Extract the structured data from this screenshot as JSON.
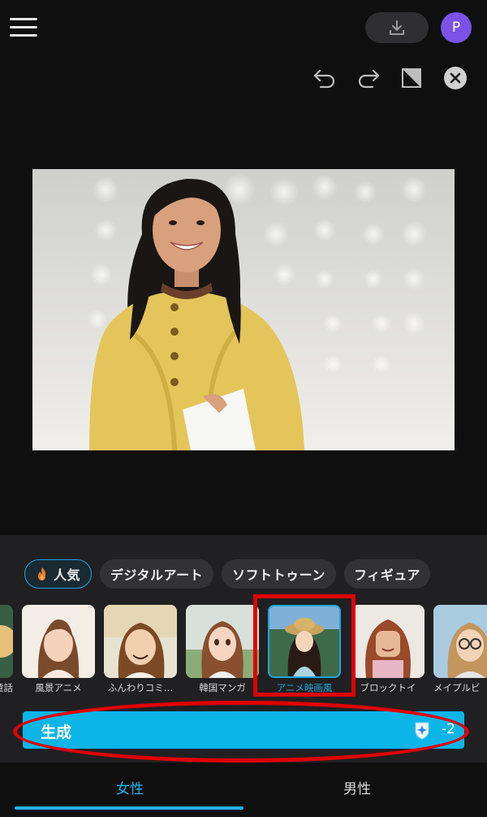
{
  "header": {
    "avatar_letter": "P",
    "menu_icon": "hamburger-icon",
    "download_icon": "download-icon"
  },
  "toolbar": {
    "icons": [
      "undo-icon",
      "redo-icon",
      "compare-icon",
      "close-icon"
    ]
  },
  "categories": [
    {
      "label": "人気",
      "icon": "fire-icon",
      "active": true
    },
    {
      "label": "デジタルアート",
      "active": false
    },
    {
      "label": "ソフトトゥーン",
      "active": false
    },
    {
      "label": "フィギュア",
      "active": false
    }
  ],
  "styles": [
    {
      "label": "童話"
    },
    {
      "label": "風景アニメ"
    },
    {
      "label": "ふんわりコミ…"
    },
    {
      "label": "韓国マンガ"
    },
    {
      "label": "アニメ映画風",
      "selected": true
    },
    {
      "label": "ブロックトイ"
    },
    {
      "label": "メイプルビ"
    }
  ],
  "generate": {
    "label": "生成",
    "cost": "-2"
  },
  "tabs": {
    "female": "女性",
    "male": "男性"
  },
  "colors": {
    "accent": "#0bb5e8",
    "highlight": "#e00000",
    "avatar": "#7b52e8"
  }
}
